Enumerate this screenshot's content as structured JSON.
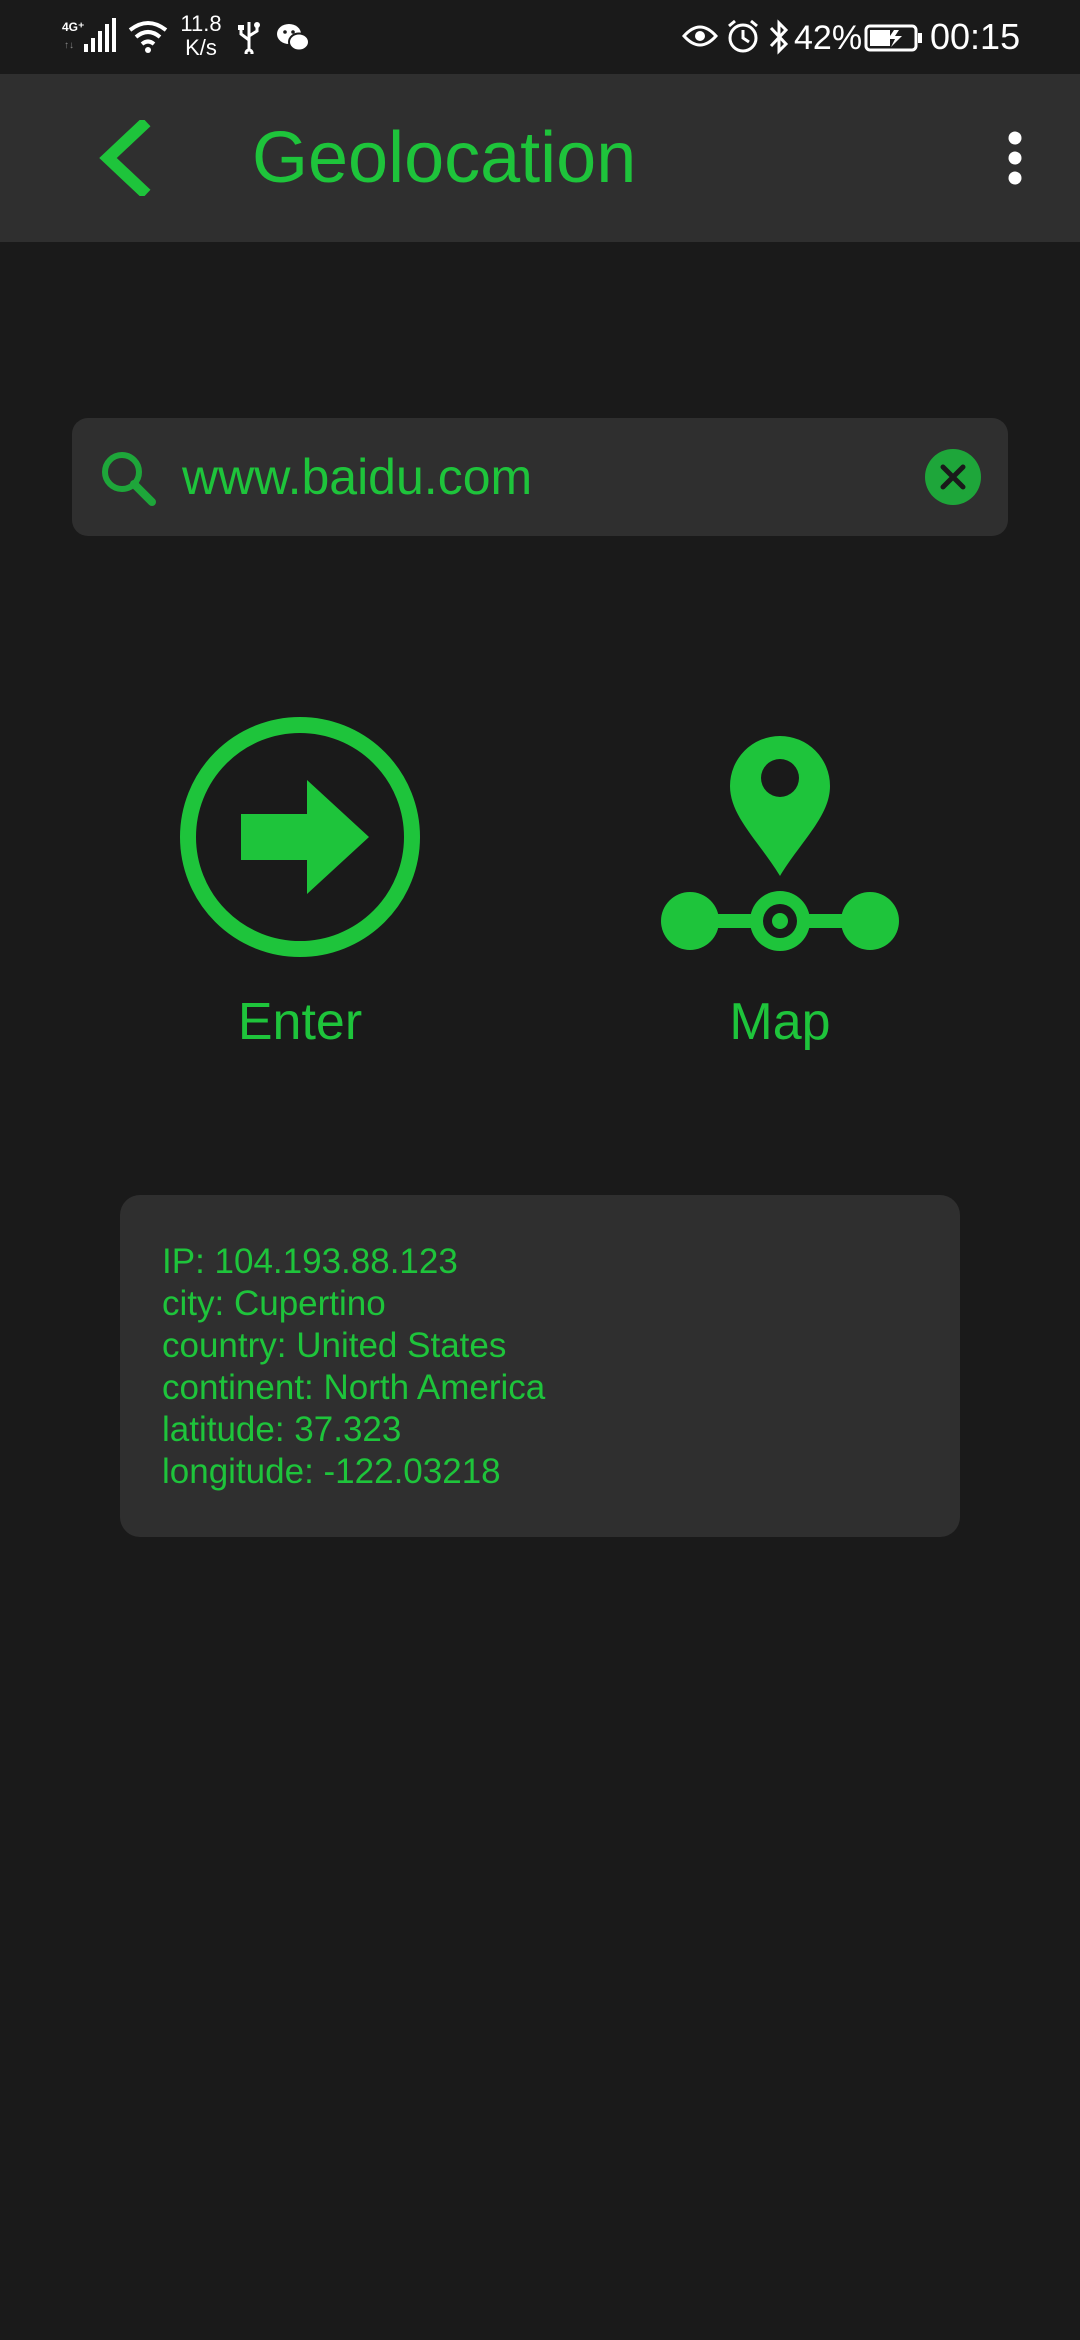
{
  "status_bar": {
    "network": "4G",
    "speed_value": "11.8",
    "speed_unit": "K/s",
    "battery_percent": "42%",
    "time": "00:15"
  },
  "app_bar": {
    "title": "Geolocation",
    "back_icon": "chevron-left-icon",
    "menu_icon": "more-vert-icon"
  },
  "search": {
    "value": "www.baidu.com",
    "placeholder": "",
    "icon": "search-icon",
    "clear_icon": "close-circle-icon"
  },
  "actions": {
    "enter_label": "Enter",
    "map_label": "Map"
  },
  "info": {
    "ip": "IP: 104.193.88.123",
    "city": "city: Cupertino",
    "country": "country: United States",
    "continent": "continent: North America",
    "latitude": "latitude: 37.323",
    "longitude": "longitude: -122.03218"
  },
  "colors": {
    "accent": "#1ec43b",
    "background": "#1a1a1a",
    "surface": "#2f2f2f"
  }
}
